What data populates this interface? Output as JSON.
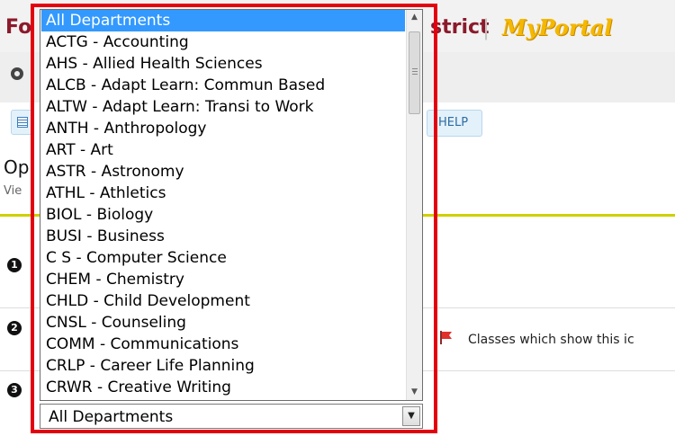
{
  "header": {
    "brand_left": "Fo",
    "brand_right": "strict",
    "separator": "|",
    "portal_logo": "MyPortal"
  },
  "toolbar": {
    "help_label": "HELP"
  },
  "page": {
    "title": "Op",
    "subtitle": "Vie"
  },
  "steps": {
    "step1": "1",
    "step2": "2",
    "step3": "3"
  },
  "legend": {
    "flag_text": "Classes which show this ic"
  },
  "dropdown": {
    "selected_value": "All Departments",
    "options": [
      "All Departments",
      "ACTG - Accounting",
      "AHS - Allied Health Sciences",
      "ALCB - Adapt Learn: Commun Based",
      "ALTW - Adapt Learn: Transi to Work",
      "ANTH - Anthropology",
      "ART - Art",
      "ASTR - Astronomy",
      "ATHL - Athletics",
      "BIOL - Biology",
      "BUSI - Business",
      "C S - Computer Science",
      "CHEM - Chemistry",
      "CHLD - Child Development",
      "CNSL - Counseling",
      "COMM - Communications",
      "CRLP - Career Life Planning",
      "CRWR - Creative Writing"
    ]
  },
  "colors": {
    "highlight_frame": "#e3000f",
    "selected_option_bg": "#3399ff",
    "brand": "#8b1a2b",
    "portal_logo": "#f5b800",
    "rule": "#cfcf00"
  },
  "icons": {
    "scroll_up": "▲",
    "scroll_down": "▼",
    "select_arrow": "▼"
  }
}
